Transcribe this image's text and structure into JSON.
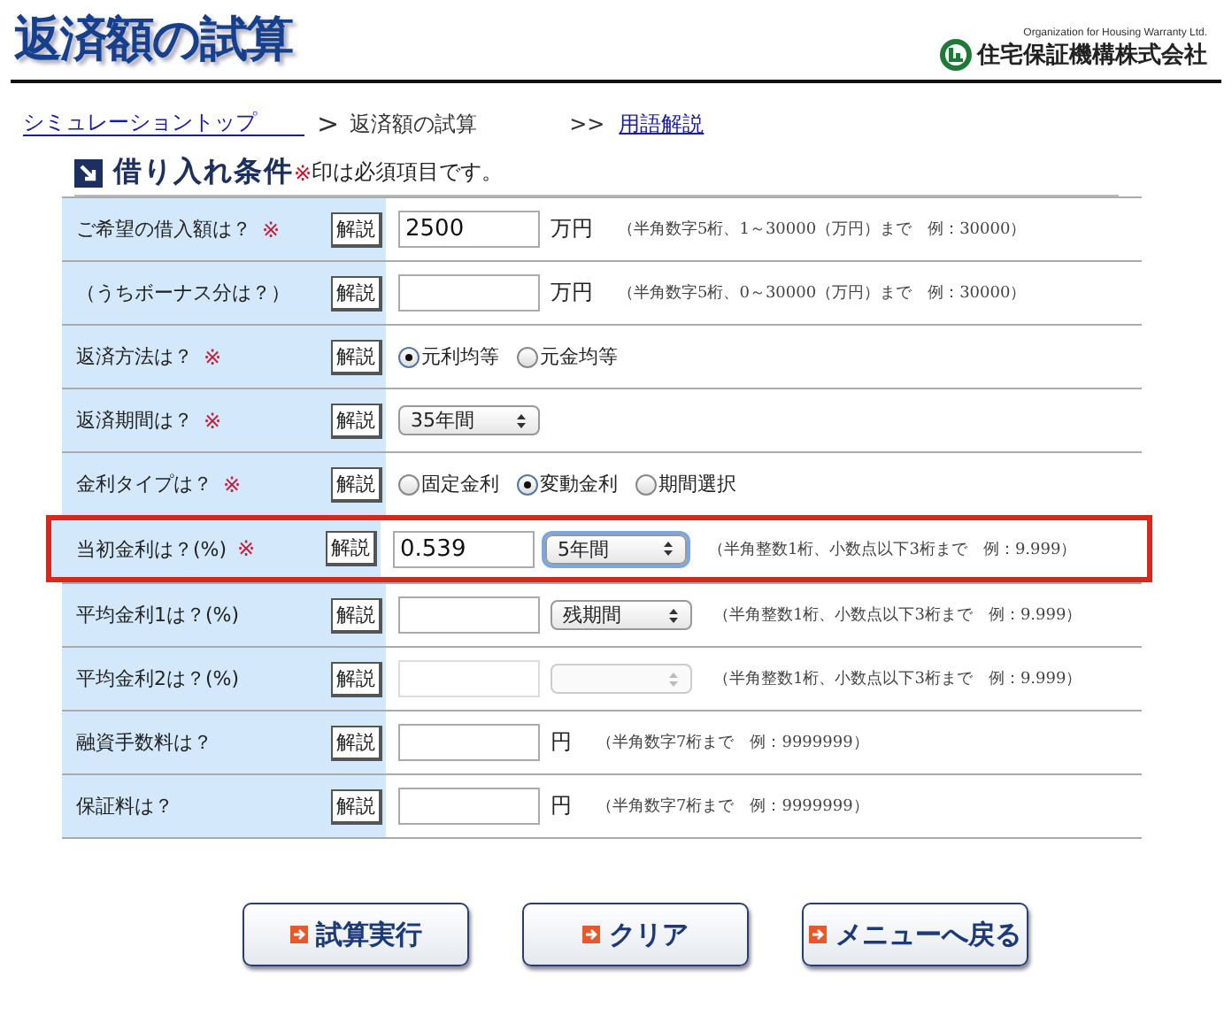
{
  "header": {
    "title": "返済額の試算",
    "org_en": "Organization for Housing Warranty Ltd.",
    "org_name": "住宅保証機構株式会社"
  },
  "breadcrumb": {
    "home": "シミュレーショントップ",
    "separator": ">",
    "current": "返済額の試算",
    "glossary_prefix": ">>",
    "glossary": "用語解説"
  },
  "section": {
    "title": "借り入れ条件",
    "note_mark": "※",
    "note": "印は必須項目です。"
  },
  "rows": [
    {
      "label": "ご希望の借入額は？",
      "required": true,
      "help": "解説",
      "highlighted": false,
      "controls": [
        {
          "kind": "input",
          "value": "2500",
          "disabled": false
        },
        {
          "kind": "unit",
          "text": "万円"
        },
        {
          "kind": "hint",
          "text": "（半角数字5桁、1～30000（万円）まで　例：30000）"
        }
      ]
    },
    {
      "label": "（うちボーナス分は？）",
      "required": false,
      "help": "解説",
      "highlighted": false,
      "controls": [
        {
          "kind": "input",
          "disabled": false
        },
        {
          "kind": "unit",
          "text": "万円"
        },
        {
          "kind": "hint",
          "text": "（半角数字5桁、0～30000（万円）まで　例：30000）"
        }
      ]
    },
    {
      "label": "返済方法は？",
      "required": true,
      "help": "解説",
      "highlighted": false,
      "controls": [
        {
          "kind": "radio",
          "text": "元利均等",
          "selected": true
        },
        {
          "kind": "radio",
          "text": "元金均等",
          "selected": false
        }
      ]
    },
    {
      "label": "返済期間は？",
      "required": true,
      "help": "解説",
      "highlighted": false,
      "controls": [
        {
          "kind": "select",
          "value": "35年間",
          "disabled": false,
          "focused": false
        }
      ]
    },
    {
      "label": "金利タイプは？",
      "required": true,
      "help": "解説",
      "highlighted": false,
      "controls": [
        {
          "kind": "radio",
          "text": "固定金利",
          "selected": false
        },
        {
          "kind": "radio",
          "text": "変動金利",
          "selected": true
        },
        {
          "kind": "radio",
          "text": "期間選択",
          "selected": false
        }
      ]
    },
    {
      "label": "当初金利は？(%)",
      "required": true,
      "help": "解説",
      "highlighted": true,
      "controls": [
        {
          "kind": "input",
          "value": "0.539",
          "disabled": false
        },
        {
          "kind": "select",
          "value": "5年間",
          "disabled": false,
          "focused": true
        },
        {
          "kind": "hint",
          "text": "（半角整数1桁、小数点以下3桁まで　例：9.999）"
        }
      ]
    },
    {
      "label": "平均金利1は？(%)",
      "required": false,
      "help": "解説",
      "highlighted": false,
      "controls": [
        {
          "kind": "input",
          "disabled": false
        },
        {
          "kind": "select",
          "value": "残期間",
          "disabled": false,
          "focused": false
        },
        {
          "kind": "hint",
          "text": "（半角整数1桁、小数点以下3桁まで　例：9.999）"
        }
      ]
    },
    {
      "label": "平均金利2は？(%)",
      "required": false,
      "help": "解説",
      "highlighted": false,
      "controls": [
        {
          "kind": "input",
          "disabled": true
        },
        {
          "kind": "select",
          "disabled": true,
          "focused": false
        },
        {
          "kind": "hint",
          "text": "（半角整数1桁、小数点以下3桁まで　例：9.999）"
        }
      ]
    },
    {
      "label": "融資手数料は？",
      "required": false,
      "help": "解説",
      "highlighted": false,
      "controls": [
        {
          "kind": "input",
          "disabled": false
        },
        {
          "kind": "unit",
          "text": "円"
        },
        {
          "kind": "hint",
          "text": "（半角数字7桁まで　例：9999999）"
        }
      ]
    },
    {
      "label": "保証料は？",
      "required": false,
      "help": "解説",
      "highlighted": false,
      "controls": [
        {
          "kind": "input",
          "disabled": false
        },
        {
          "kind": "unit",
          "text": "円"
        },
        {
          "kind": "hint",
          "text": "（半角数字7桁まで　例：9999999）"
        }
      ]
    }
  ],
  "buttons": [
    {
      "label": "試算実行"
    },
    {
      "label": "クリア"
    },
    {
      "label": "メニューへ戻る"
    }
  ]
}
